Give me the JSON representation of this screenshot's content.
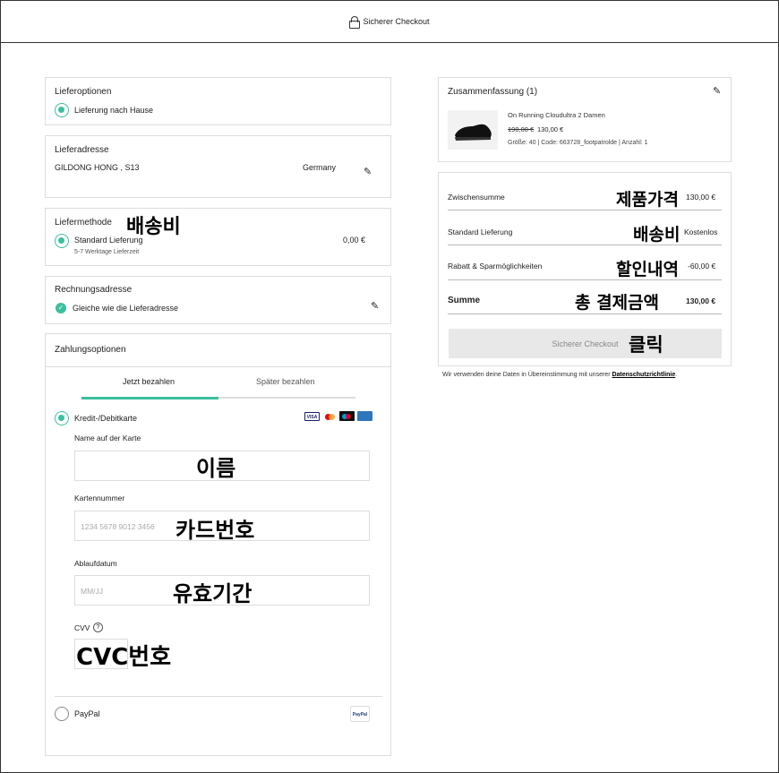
{
  "header": {
    "title": "Sicherer Checkout"
  },
  "lieferoptionen": {
    "title": "Lieferoptionen",
    "option": "Lieferung nach Hause"
  },
  "lieferadresse": {
    "title": "Lieferadresse",
    "name": "GILDONG HONG , S13",
    "country": "Germany"
  },
  "liefermethode": {
    "title": "Liefermethode",
    "annotation": "배송비",
    "option": "Standard Lieferung",
    "duration": "5-7 Werktage Lieferzeit",
    "price": "0,00 €"
  },
  "rechnungsadresse": {
    "title": "Rechnungsadresse",
    "option": "Gleiche wie die Lieferadresse"
  },
  "zahlung": {
    "title": "Zahlungsoptionen",
    "tabs": [
      "Jetzt bezahlen",
      "Später bezahlen"
    ],
    "card_option": "Kredit-/Debitkarte",
    "card_logos": [
      "VISA",
      "MC",
      "MAESTRO",
      "AMEX"
    ],
    "name_label": "Name auf der Karte",
    "name_annotation": "이름",
    "number_label": "Kartennummer",
    "number_placeholder": "1234 5678 9012 3456",
    "number_annotation": "카드번호",
    "expiry_label": "Ablaufdatum",
    "expiry_placeholder": "MM/JJ",
    "expiry_annotation": "유효기간",
    "cvv_label": "CVV",
    "cvv_annotation": "CVC번호",
    "paypal_option": "PayPal",
    "paypal_logo": "PayPal"
  },
  "summary": {
    "title": "Zusammenfassung (1)",
    "product_name": "On Running Cloudultra 2 Damen",
    "old_price": "190,00 €",
    "new_price": "130,00 €",
    "details": "Größe: 40 | Code: 663728_footpatrolde | Anzahl: 1"
  },
  "totals": {
    "rows": [
      {
        "label": "Zwischensumme",
        "annotation": "제품가격",
        "value": "130,00 €"
      },
      {
        "label": "Standard Lieferung",
        "annotation": "배송비",
        "value": "Kostenlos"
      },
      {
        "label": "Rabatt & Sparmöglichkeiten",
        "annotation": "할인내역",
        "value": "-60,00 €"
      },
      {
        "label": "Summe",
        "annotation": "총 결제금액",
        "value": "130,00 €"
      }
    ],
    "button": "Sicherer Checkout",
    "button_annotation": "클릭",
    "privacy_text": "Wir verwenden deine Daten in Übereinstimmung mit unserer",
    "privacy_link": "Datenschutzrichtlinie",
    "privacy_end": "."
  },
  "colors": {
    "accent": "#3cbf9e",
    "button_bg": "#e8e8e8"
  }
}
